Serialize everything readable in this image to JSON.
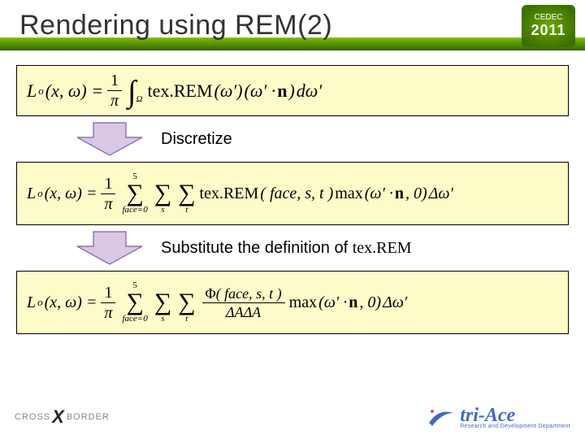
{
  "header": {
    "title": "Rendering using REM(2)",
    "badge_top": "CEDEC",
    "badge_year": "2011"
  },
  "equations": {
    "eq1": {
      "lhs_L": "L",
      "lhs_sub": "o",
      "lhs_args": "(x, ω) =",
      "frac_num": "1",
      "frac_den": "π",
      "int": "∫",
      "int_sub": "Ω",
      "tex": "tex.REM",
      "omega_prime": "(ω′)",
      "dot": "(ω′ · ",
      "n": "n",
      "close": ")",
      "domega": "dω′"
    },
    "eq2": {
      "lhs_L": "L",
      "lhs_sub": "o",
      "lhs_args": "(x, ω) =",
      "frac_num": "1",
      "frac_den": "π",
      "sum1_top": "5",
      "sum1_bot": "face=0",
      "sum2_bot": "s",
      "sum3_bot": "t",
      "tex": "tex.REM",
      "args": "( face, s, t )",
      "max": "max",
      "maxargs": "(ω′ · ",
      "n": "n",
      "maxrest": ", 0)",
      "domega": "Δω′"
    },
    "eq3": {
      "lhs_L": "L",
      "lhs_sub": "o",
      "lhs_args": "(x, ω) =",
      "frac_num": "1",
      "frac_den": "π",
      "sum1_top": "5",
      "sum1_bot": "face=0",
      "sum2_bot": "s",
      "sum3_bot": "t",
      "phi": "Φ",
      "phi_args": "( face, s, t )",
      "den": "ΔAΔA",
      "max": "max",
      "maxargs": "(ω′ · ",
      "n": "n",
      "maxrest": ", 0)",
      "domega": "Δω′"
    }
  },
  "arrows": {
    "label1": "Discretize",
    "label2_a": "Substitute the definition of ",
    "label2_b": "tex.REM",
    "fill": "#d9c7e6",
    "stroke": "#7a5ea0"
  },
  "footer": {
    "cross_left": "CROSS",
    "cross_right": "BORDER",
    "triace": "tri-Ace",
    "triace_sub": "Research and Development Department"
  }
}
